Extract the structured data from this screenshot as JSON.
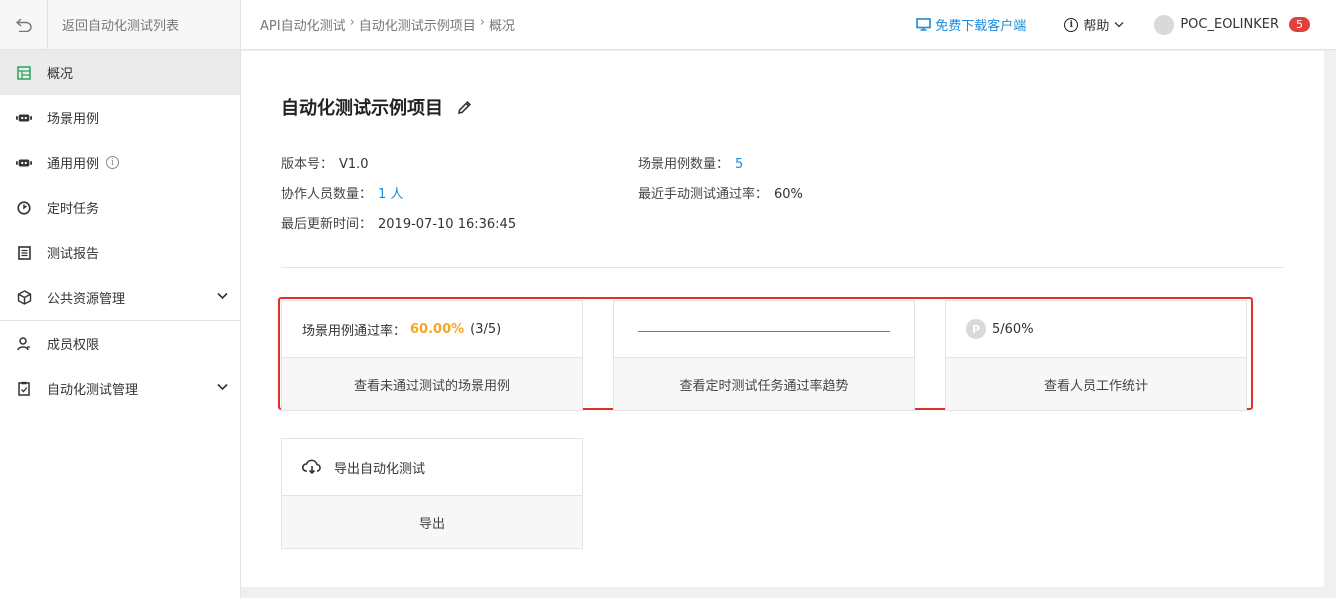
{
  "sidebar": {
    "back_label": "返回自动化测试列表",
    "items": [
      {
        "label": "概况",
        "icon": "overview-icon",
        "active": true
      },
      {
        "label": "场景用例",
        "icon": "robot-icon"
      },
      {
        "label": "通用用例",
        "icon": "robot-icon",
        "info": "i"
      },
      {
        "label": "定时任务",
        "icon": "clock-icon"
      },
      {
        "label": "测试报告",
        "icon": "report-icon"
      },
      {
        "label": "公共资源管理",
        "icon": "cube-icon"
      },
      {
        "label": "成员权限",
        "icon": "user-icon"
      },
      {
        "label": "自动化测试管理",
        "icon": "clipboard-icon"
      }
    ]
  },
  "header": {
    "breadcrumb": [
      "API自动化测试",
      "自动化测试示例项目",
      "概况"
    ],
    "download_label": "免费下载客户端",
    "help_label": "帮助",
    "help_icon_glyph": "i",
    "user_name": "POC_EOLINKER",
    "badge": "5"
  },
  "project": {
    "title": "自动化测试示例项目",
    "version_label": "版本号：",
    "version": "V1.0",
    "scene_count_label": "场景用例数量：",
    "scene_count": "5",
    "members_label": "协作人员数量：",
    "members": "1 人",
    "pass_rate_label": "最近手动测试通过率：",
    "pass_rate": "60%",
    "updated_label": "最后更新时间：",
    "updated": "2019-07-10 16:36:45"
  },
  "cards": {
    "scene": {
      "label": "场景用例通过率：",
      "rate": "60.00%",
      "count": "(3/5)",
      "action": "查看未通过测试的场景用例"
    },
    "trend": {
      "action": "查看定时测试任务通过率趋势"
    },
    "people": {
      "badge": "P",
      "value": "5/60%",
      "action": "查看人员工作统计"
    },
    "export": {
      "label": "导出自动化测试",
      "action": "导出"
    }
  },
  "colors": {
    "accent": "#1a8adb",
    "highlight": "#e0302a",
    "rate": "#f5a623",
    "badge": "#e0413d"
  }
}
